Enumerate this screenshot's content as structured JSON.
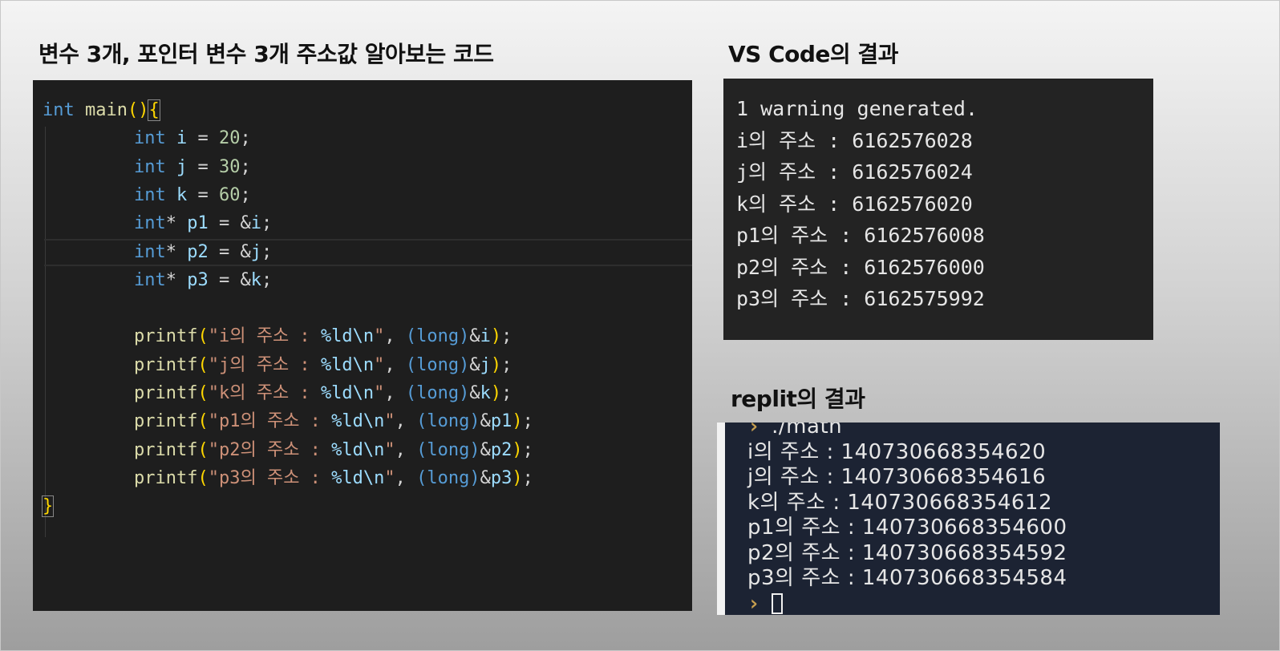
{
  "headings": {
    "code_title": "변수 3개, 포인터 변수 3개 주소값 알아보는 코드",
    "vscode_title": "VS Code의 결과",
    "replit_title": "replit의 결과"
  },
  "editor": {
    "header": [
      {
        "t": "int",
        "c": "kw"
      },
      {
        "t": " ",
        "c": "pl"
      },
      {
        "t": "main",
        "c": "fn"
      },
      {
        "t": "()",
        "c": "br"
      },
      {
        "t": "{",
        "c": "br"
      }
    ],
    "decls": [
      [
        {
          "t": "int",
          "c": "kw"
        },
        {
          "t": " ",
          "c": "pl"
        },
        {
          "t": "i",
          "c": "var"
        },
        {
          "t": " = ",
          "c": "pl"
        },
        {
          "t": "20",
          "c": "num"
        },
        {
          "t": ";",
          "c": "pl"
        }
      ],
      [
        {
          "t": "int",
          "c": "kw"
        },
        {
          "t": " ",
          "c": "pl"
        },
        {
          "t": "j",
          "c": "var"
        },
        {
          "t": " = ",
          "c": "pl"
        },
        {
          "t": "30",
          "c": "num"
        },
        {
          "t": ";",
          "c": "pl"
        }
      ],
      [
        {
          "t": "int",
          "c": "kw"
        },
        {
          "t": " ",
          "c": "pl"
        },
        {
          "t": "k",
          "c": "var"
        },
        {
          "t": " = ",
          "c": "pl"
        },
        {
          "t": "60",
          "c": "num"
        },
        {
          "t": ";",
          "c": "pl"
        }
      ],
      [
        {
          "t": "int",
          "c": "kw"
        },
        {
          "t": "* ",
          "c": "pl"
        },
        {
          "t": "p1",
          "c": "var"
        },
        {
          "t": " = &",
          "c": "pl"
        },
        {
          "t": "i",
          "c": "var"
        },
        {
          "t": ";",
          "c": "pl"
        }
      ],
      [
        {
          "t": "int",
          "c": "kw"
        },
        {
          "t": "* ",
          "c": "pl"
        },
        {
          "t": "p2",
          "c": "var"
        },
        {
          "t": " = &",
          "c": "pl"
        },
        {
          "t": "j",
          "c": "var"
        },
        {
          "t": ";",
          "c": "pl"
        }
      ],
      [
        {
          "t": "int",
          "c": "kw"
        },
        {
          "t": "* ",
          "c": "pl"
        },
        {
          "t": "p3",
          "c": "var"
        },
        {
          "t": " = &",
          "c": "pl"
        },
        {
          "t": "k",
          "c": "var"
        },
        {
          "t": ";",
          "c": "pl"
        }
      ]
    ],
    "prints": [
      [
        {
          "t": "printf",
          "c": "fn"
        },
        {
          "t": "(",
          "c": "br"
        },
        {
          "t": "\"i의 주소 : ",
          "c": "str"
        },
        {
          "t": "%ld\\n",
          "c": "fmt"
        },
        {
          "t": "\"",
          "c": "str"
        },
        {
          "t": ", ",
          "c": "pl"
        },
        {
          "t": "(long)",
          "c": "kw"
        },
        {
          "t": "&",
          "c": "pl"
        },
        {
          "t": "i",
          "c": "var"
        },
        {
          "t": ")",
          "c": "br"
        },
        {
          "t": ";",
          "c": "pl"
        }
      ],
      [
        {
          "t": "printf",
          "c": "fn"
        },
        {
          "t": "(",
          "c": "br"
        },
        {
          "t": "\"j의 주소 : ",
          "c": "str"
        },
        {
          "t": "%ld\\n",
          "c": "fmt"
        },
        {
          "t": "\"",
          "c": "str"
        },
        {
          "t": ", ",
          "c": "pl"
        },
        {
          "t": "(long)",
          "c": "kw"
        },
        {
          "t": "&",
          "c": "pl"
        },
        {
          "t": "j",
          "c": "var"
        },
        {
          "t": ")",
          "c": "br"
        },
        {
          "t": ";",
          "c": "pl"
        }
      ],
      [
        {
          "t": "printf",
          "c": "fn"
        },
        {
          "t": "(",
          "c": "br"
        },
        {
          "t": "\"k의 주소 : ",
          "c": "str"
        },
        {
          "t": "%ld\\n",
          "c": "fmt"
        },
        {
          "t": "\"",
          "c": "str"
        },
        {
          "t": ", ",
          "c": "pl"
        },
        {
          "t": "(long)",
          "c": "kw"
        },
        {
          "t": "&",
          "c": "pl"
        },
        {
          "t": "k",
          "c": "var"
        },
        {
          "t": ")",
          "c": "br"
        },
        {
          "t": ";",
          "c": "pl"
        }
      ],
      [
        {
          "t": "printf",
          "c": "fn"
        },
        {
          "t": "(",
          "c": "br"
        },
        {
          "t": "\"p1의 주소 : ",
          "c": "str"
        },
        {
          "t": "%ld\\n",
          "c": "fmt"
        },
        {
          "t": "\"",
          "c": "str"
        },
        {
          "t": ", ",
          "c": "pl"
        },
        {
          "t": "(long)",
          "c": "kw"
        },
        {
          "t": "&",
          "c": "pl"
        },
        {
          "t": "p1",
          "c": "var"
        },
        {
          "t": ")",
          "c": "br"
        },
        {
          "t": ";",
          "c": "pl"
        }
      ],
      [
        {
          "t": "printf",
          "c": "fn"
        },
        {
          "t": "(",
          "c": "br"
        },
        {
          "t": "\"p2의 주소 : ",
          "c": "str"
        },
        {
          "t": "%ld\\n",
          "c": "fmt"
        },
        {
          "t": "\"",
          "c": "str"
        },
        {
          "t": ", ",
          "c": "pl"
        },
        {
          "t": "(long)",
          "c": "kw"
        },
        {
          "t": "&",
          "c": "pl"
        },
        {
          "t": "p2",
          "c": "var"
        },
        {
          "t": ")",
          "c": "br"
        },
        {
          "t": ";",
          "c": "pl"
        }
      ],
      [
        {
          "t": "printf",
          "c": "fn"
        },
        {
          "t": "(",
          "c": "br"
        },
        {
          "t": "\"p3의 주소 : ",
          "c": "str"
        },
        {
          "t": "%ld\\n",
          "c": "fmt"
        },
        {
          "t": "\"",
          "c": "str"
        },
        {
          "t": ", ",
          "c": "pl"
        },
        {
          "t": "(long)",
          "c": "kw"
        },
        {
          "t": "&",
          "c": "pl"
        },
        {
          "t": "p3",
          "c": "var"
        },
        {
          "t": ")",
          "c": "br"
        },
        {
          "t": ";",
          "c": "pl"
        }
      ]
    ],
    "closing": "}"
  },
  "vscode_output": {
    "lines": [
      "1 warning generated.",
      "i의 주소 : 6162576028",
      "j의 주소 : 6162576024",
      "k의 주소 : 6162576020",
      "p1의 주소 : 6162576008",
      "p2의 주소 : 6162576000",
      "p3의 주소 : 6162575992"
    ]
  },
  "replit_output": {
    "prompt_symbol": "›",
    "command": "./math",
    "lines": [
      "i의 주소 : 140730668354620",
      "j의 주소 : 140730668354616",
      "k의 주소 : 140730668354612",
      "p1의 주소 : 140730668354600",
      "p2의 주소 : 140730668354592",
      "p3의 주소 : 140730668354584"
    ]
  },
  "colors": {
    "editor_bg": "#1e1e1e",
    "keyword": "#569cd6",
    "function": "#dcdcaa",
    "string": "#ce9178",
    "number": "#b5cea8",
    "bracket": "#ffd700",
    "replit_bg": "#1c2333"
  }
}
